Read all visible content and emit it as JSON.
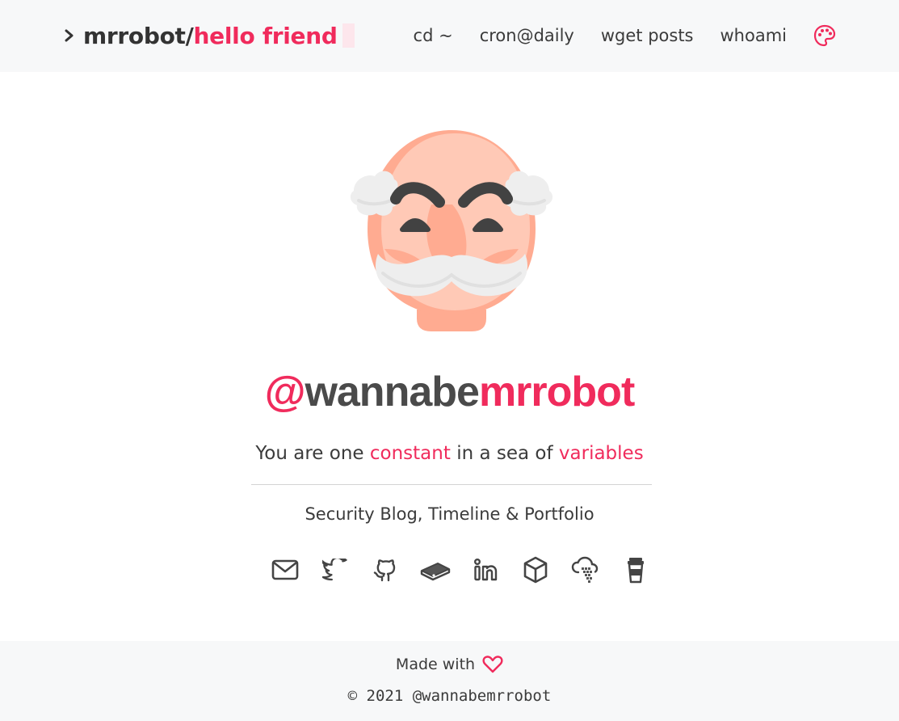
{
  "header": {
    "brand": {
      "main": "mrrobot/",
      "accent": "hello friend"
    },
    "nav": [
      {
        "label": "cd ~"
      },
      {
        "label": "cron@daily"
      },
      {
        "label": "wget posts"
      },
      {
        "label": "whoami"
      }
    ],
    "theme_icon": "palette-icon"
  },
  "hero": {
    "avatar_icon": "mr-robot-mask-avatar",
    "handle": {
      "at": "@",
      "mid": "wannabe",
      "end": "mrrobot"
    },
    "tagline": {
      "t1": "You are one ",
      "h1": "constant",
      "t2": " in a sea of ",
      "h2": "variables"
    },
    "subtitle": "Security Blog, Timeline & Portfolio"
  },
  "socials": [
    "email-icon",
    "twitter-icon",
    "github-icon",
    "book-icon",
    "linkedin-icon",
    "box-icon",
    "cloud-icon",
    "coffee-cup-icon"
  ],
  "footer": {
    "made_with": "Made with",
    "copyright": "© 2021 @wannabemrrobot"
  },
  "colors": {
    "accent": "#f02b5c",
    "text": "#3b3b3b",
    "bar_bg": "#f7f8f9"
  }
}
